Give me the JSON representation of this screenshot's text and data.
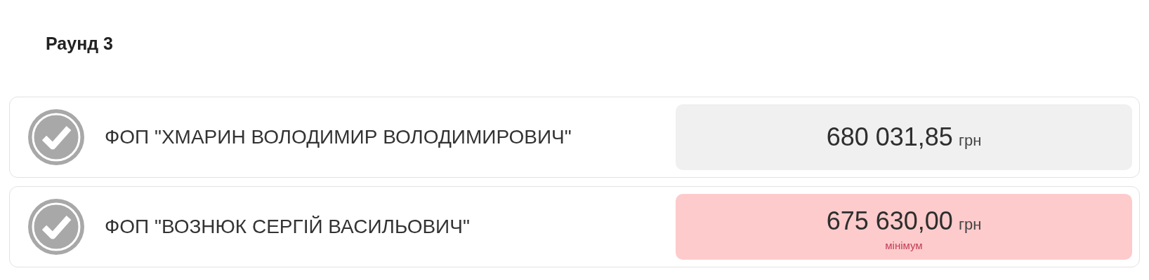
{
  "round_title": "Раунд 3",
  "bids": [
    {
      "name": "ФОП \"ХМАРИН ВОЛОДИМИР ВОЛОДИМИРОВИЧ\"",
      "amount": "680 031,85",
      "currency": "грн",
      "minimum": false
    },
    {
      "name": "ФОП \"ВОЗНЮК СЕРГІЙ ВАСИЛЬОВИЧ\"",
      "amount": "675 630,00",
      "currency": "грн",
      "minimum": true,
      "note": "мінімум"
    }
  ]
}
